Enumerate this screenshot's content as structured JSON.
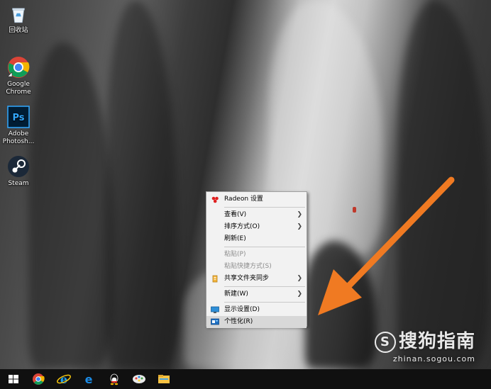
{
  "desktop_icons": [
    {
      "label": "回收站",
      "icon": "recycle-bin-icon"
    },
    {
      "label": "Google Chrome",
      "icon": "chrome-icon"
    },
    {
      "label": "Adobe Photosh...",
      "icon": "photoshop-icon"
    },
    {
      "label": "Steam",
      "icon": "steam-icon"
    }
  ],
  "context_menu": {
    "items": [
      {
        "label": "Radeon 设置",
        "icon": "radeon-icon"
      },
      {
        "label": "查看(V)",
        "submenu": true
      },
      {
        "label": "排序方式(O)",
        "submenu": true
      },
      {
        "label": "刷新(E)"
      },
      {
        "label": "粘贴(P)",
        "disabled": true
      },
      {
        "label": "粘贴快捷方式(S)",
        "disabled": true
      },
      {
        "label": "共享文件夹同步",
        "icon": "folder-sync-icon",
        "submenu": true
      },
      {
        "label": "新建(W)",
        "submenu": true
      },
      {
        "label": "显示设置(D)",
        "icon": "display-icon"
      },
      {
        "label": "个性化(R)",
        "icon": "personalize-icon",
        "hovered": true
      }
    ]
  },
  "taskbar": {
    "icons": [
      "windows-start-icon",
      "chrome-icon",
      "ie-icon",
      "edge-icon",
      "qq-icon",
      "paint-icon",
      "file-explorer-icon"
    ]
  },
  "watermark": {
    "brand": "搜狗指南",
    "url": "zhinan.sogou.com"
  },
  "colors": {
    "arrow": "#f07a22",
    "taskbar": "#101010",
    "menu_bg": "#f2f2f2"
  }
}
